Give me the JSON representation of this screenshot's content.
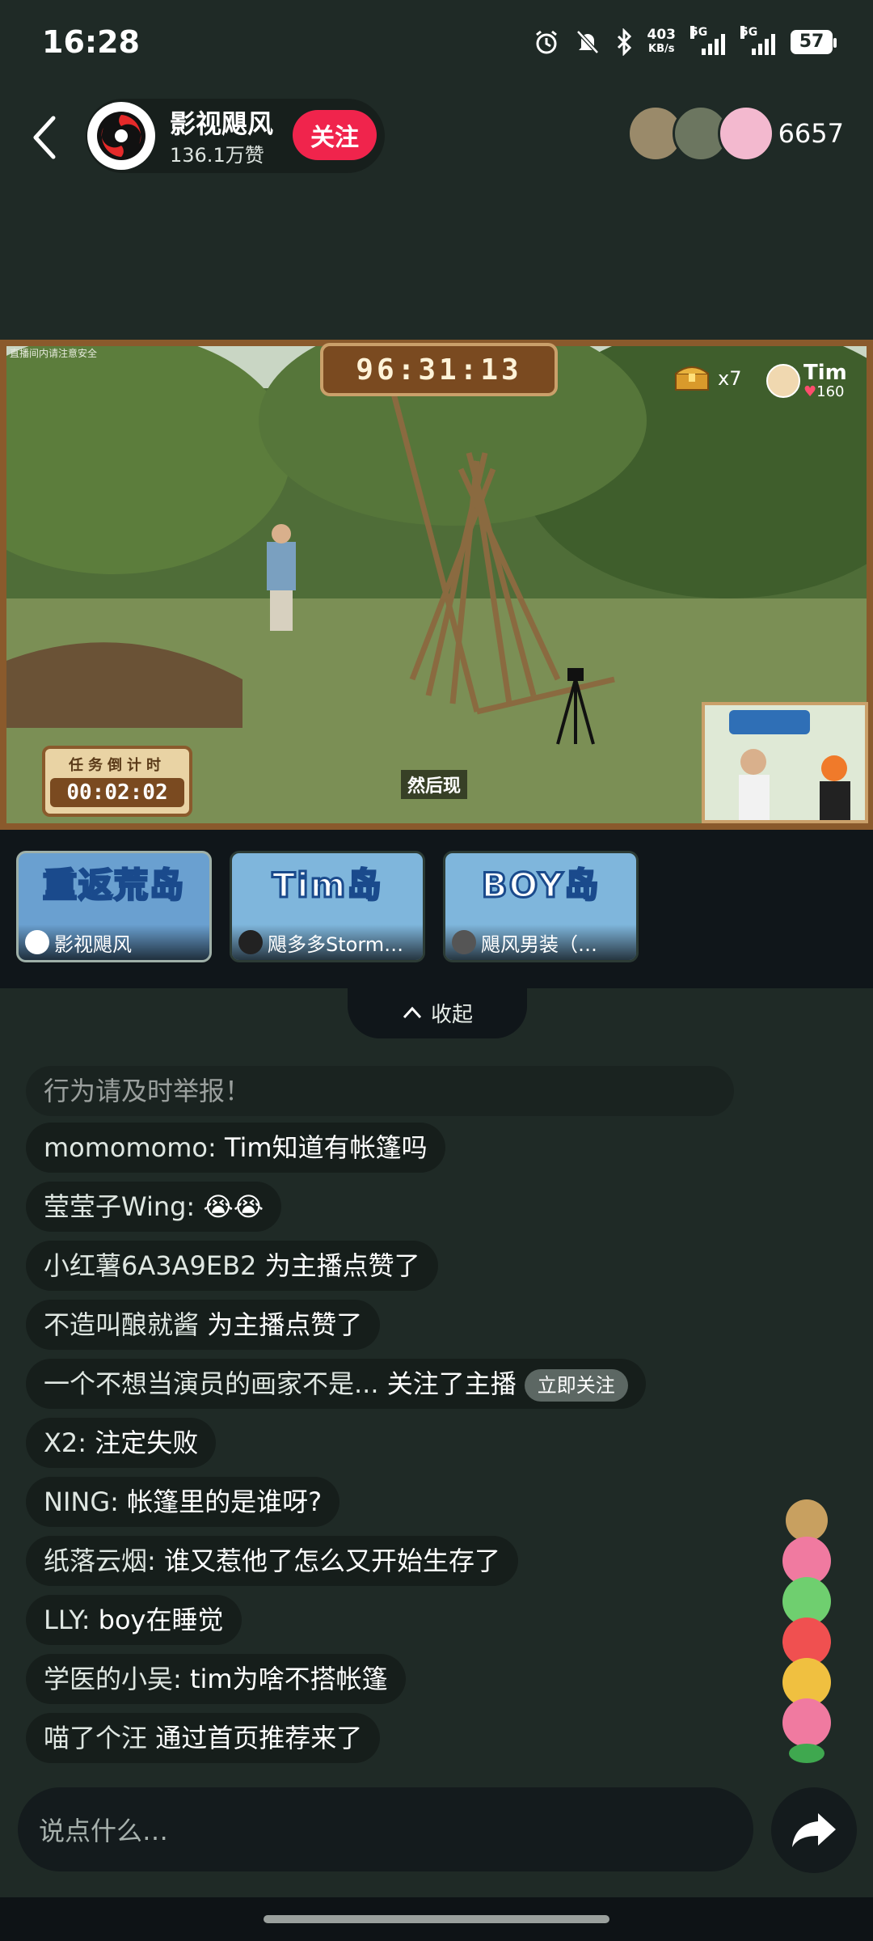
{
  "status_bar": {
    "time": "16:28",
    "net_speed_value": "403",
    "net_speed_unit": "KB/s",
    "signal1_label": "5G",
    "signal2_label": "5G",
    "battery": "57"
  },
  "header": {
    "host_name": "影视飓风",
    "host_likes": "136.1万赞",
    "follow_label": "关注",
    "viewer_count": "6657"
  },
  "video": {
    "countdown_top": "96:31:13",
    "chest_count": "x7",
    "tim_name": "Tim",
    "tim_score": "160",
    "task_label": "任务倒计时",
    "task_time": "00:02:02",
    "subtitle": "然后现"
  },
  "thumbnails": [
    {
      "title": "重返荒岛",
      "name": "影视飓风"
    },
    {
      "title": "Tim岛",
      "name": "飓多多Storm…"
    },
    {
      "title": "BOY岛",
      "name": "飓风男装（…"
    }
  ],
  "collapse_label": "收起",
  "chat": [
    {
      "nick": "",
      "msg": "行为请及时举报！",
      "fade": true
    },
    {
      "nick": "momomomo: ",
      "msg": "Tim知道有帐篷吗"
    },
    {
      "nick": "莹莹子Wing: ",
      "msg": "😭😭"
    },
    {
      "nick": "小红薯6A3A9EB2 ",
      "msg": "为主播点赞了"
    },
    {
      "nick": "不造叫酿就酱 ",
      "msg": "为主播点赞了"
    },
    {
      "nick": "一个不想当演员的画家不是... ",
      "msg": "关注了主播",
      "badge": "立即关注"
    },
    {
      "nick": "X2: ",
      "msg": "注定失败"
    },
    {
      "nick": "NING: ",
      "msg": "帐篷里的是谁呀?"
    },
    {
      "nick": "纸落云烟: ",
      "msg": "谁又惹他了怎么又开始生存了"
    },
    {
      "nick": "LLY: ",
      "msg": "boy在睡觉"
    },
    {
      "nick": "学医的小吴: ",
      "msg": "tim为啥不搭帐篷"
    },
    {
      "nick": "喵了个汪 ",
      "msg": "通过首页推荐来了"
    }
  ],
  "input": {
    "placeholder": "说点什么…"
  },
  "colors": {
    "background": "#1f2a26",
    "follow": "#f0244c",
    "frame": "#8a5a2c"
  }
}
